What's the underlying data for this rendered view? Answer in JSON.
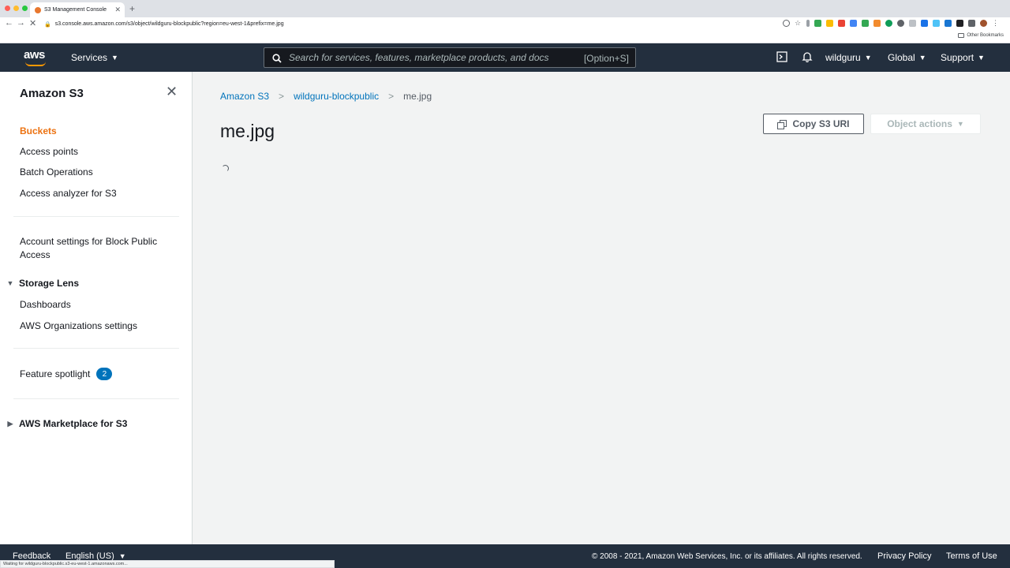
{
  "browser": {
    "tab_title": "S3 Management Console",
    "url": "s3.console.aws.amazon.com/s3/object/wildguru-blockpublic?region=eu-west-1&prefix=me.jpg",
    "other_bookmarks": "Other Bookmarks",
    "status_text": "Waiting for wildguru-blockpublic.s3-eu-west-1.amazonaws.com..."
  },
  "nav": {
    "logo": "aws",
    "services_label": "Services",
    "search_placeholder": "Search for services, features, marketplace products, and docs",
    "search_shortcut": "[Option+S]",
    "account": "wildguru",
    "region": "Global",
    "support": "Support"
  },
  "sidebar": {
    "title": "Amazon S3",
    "items": [
      "Buckets",
      "Access points",
      "Batch Operations",
      "Access analyzer for S3"
    ],
    "block_public_line1": "Account settings for Block Public",
    "block_public_line2": "Access",
    "storage_lens": {
      "label": "Storage Lens",
      "items": [
        "Dashboards",
        "AWS Organizations settings"
      ]
    },
    "feature_spotlight": "Feature spotlight",
    "feature_spotlight_count": "2",
    "marketplace": "AWS Marketplace for S3"
  },
  "main": {
    "breadcrumbs": [
      "Amazon S3",
      "wildguru-blockpublic",
      "me.jpg"
    ],
    "title": "me.jpg",
    "copy_uri_label": "Copy S3 URI",
    "object_actions_label": "Object actions"
  },
  "footer": {
    "feedback": "Feedback",
    "language": "English (US)",
    "copyright": "© 2008 - 2021, Amazon Web Services, Inc. or its affiliates. All rights reserved.",
    "privacy": "Privacy Policy",
    "terms": "Terms of Use"
  },
  "colors": {
    "nav_bg": "#232f3e",
    "accent_orange": "#ec7211",
    "link_blue": "#0073bb",
    "page_bg": "#f2f3f3"
  }
}
